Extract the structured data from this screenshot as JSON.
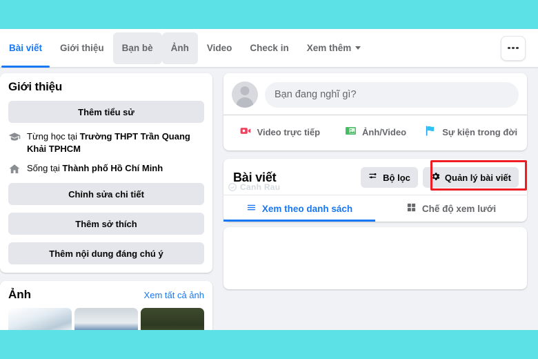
{
  "theme": {
    "band_color": "#5ce1e6",
    "accent_blue": "#1877f2",
    "highlight_red": "#ee1c25",
    "page_bg": "#f0f2f5"
  },
  "navbar": {
    "tabs": [
      {
        "label": "Bài viết",
        "state": "active"
      },
      {
        "label": "Giới thiệu",
        "state": "normal"
      },
      {
        "label": "Bạn bè",
        "state": "hovered"
      },
      {
        "label": "Ảnh",
        "state": "hovered"
      },
      {
        "label": "Video",
        "state": "normal"
      },
      {
        "label": "Check in",
        "state": "normal"
      },
      {
        "label": "Xem thêm",
        "state": "normal",
        "caret": true
      }
    ],
    "more_button": "more-options"
  },
  "sidebar": {
    "intro": {
      "title": "Giới thiệu",
      "add_bio_label": "Thêm tiểu sử",
      "details": [
        {
          "icon": "graduation-cap-icon",
          "prefix": "Từng học tại ",
          "value": "Trường THPT Trần Quang Khải TPHCM"
        },
        {
          "icon": "home-icon",
          "prefix": "Sống tại ",
          "value": "Thành phố Hồ Chí Minh"
        }
      ],
      "edit_details_label": "Chỉnh sửa chi tiết",
      "add_hobbies_label": "Thêm sở thích",
      "add_featured_label": "Thêm nội dung đáng chú ý"
    },
    "photos": {
      "title": "Ảnh",
      "see_all_label": "Xem tất cả ảnh",
      "thumbnails": [
        "photo-thumb-1",
        "photo-thumb-2",
        "photo-thumb-3"
      ]
    }
  },
  "composer": {
    "placeholder": "Bạn đang nghĩ gì?",
    "avatar": "user-avatar",
    "actions": [
      {
        "icon": "live-video-icon",
        "label": "Video trực tiếp",
        "color": "#f3425f"
      },
      {
        "icon": "photo-video-icon",
        "label": "Ảnh/Video",
        "color": "#45bd62"
      },
      {
        "icon": "life-event-icon",
        "label": "Sự kiện trong đời",
        "color": "#1d9bf0"
      }
    ]
  },
  "posts": {
    "title": "Bài viết",
    "filter_label": "Bộ lọc",
    "manage_label": "Quản lý bài viết",
    "highlighted_button": "manage-posts-button",
    "watermark": "Canh Rau",
    "view_tabs": [
      {
        "label": "Xem theo danh sách",
        "icon": "list-icon",
        "state": "active"
      },
      {
        "label": "Chế độ xem lưới",
        "icon": "grid-icon",
        "state": "normal"
      }
    ]
  }
}
